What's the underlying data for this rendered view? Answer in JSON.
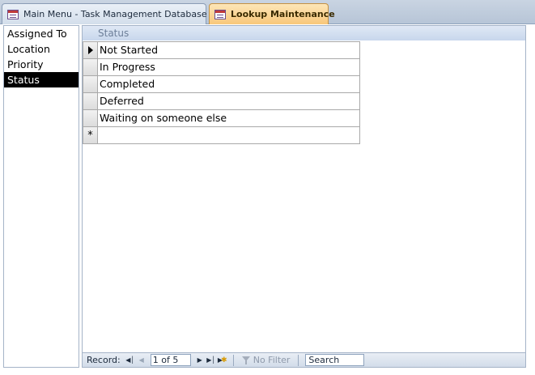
{
  "tabs": [
    {
      "label": "Main Menu - Task Management Database",
      "icon": "form-icon",
      "active": false
    },
    {
      "label": "Lookup Maintenance",
      "icon": "form-icon",
      "active": true
    }
  ],
  "lookup_list": {
    "items": [
      "Assigned To",
      "Location",
      "Priority",
      "Status"
    ],
    "selected": "Status"
  },
  "datasheet": {
    "column_header": "Status",
    "rows": [
      "Not Started",
      "In Progress",
      "Completed",
      "Deferred",
      "Waiting on someone else"
    ],
    "new_record_marker": "*"
  },
  "navigation": {
    "record_label": "Record:",
    "position": "1 of 5",
    "filter_label": "No Filter",
    "search_placeholder": "Search"
  },
  "colors": {
    "active_tab": "#f8c77a",
    "selected_item": "#000000",
    "header_bg": "#c8d7ec"
  }
}
